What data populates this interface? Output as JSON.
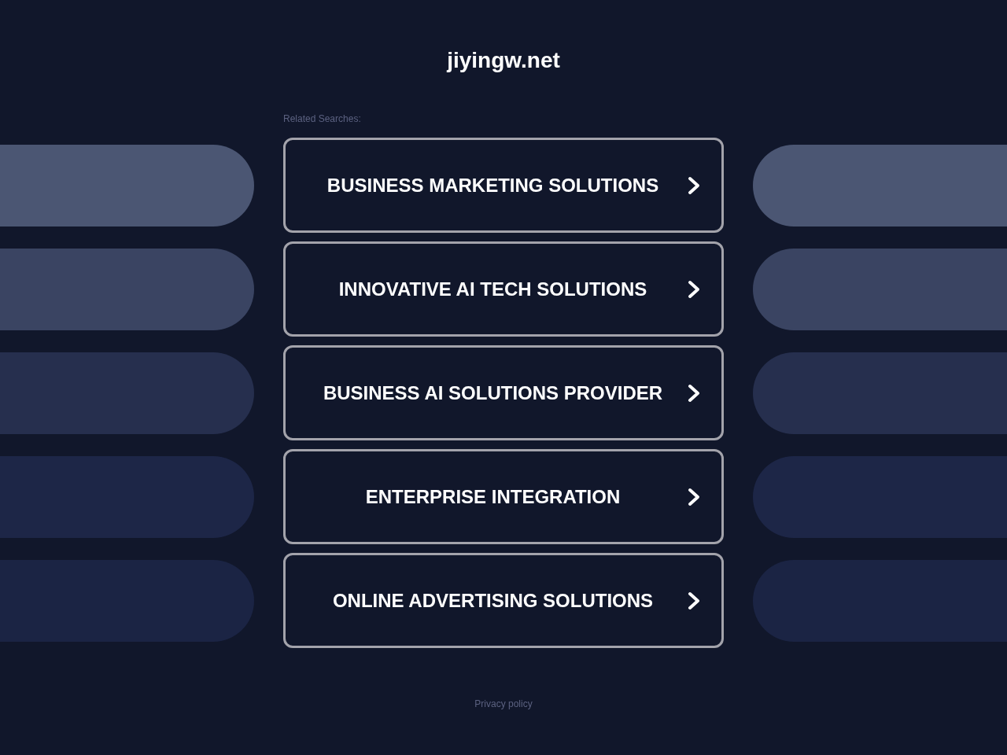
{
  "site_title": "jiyingw.net",
  "related_searches": {
    "label": "Related Searches:",
    "links": [
      {
        "label": "BUSINESS MARKETING SOLUTIONS"
      },
      {
        "label": "INNOVATIVE AI TECH SOLUTIONS"
      },
      {
        "label": "BUSINESS AI SOLUTIONS PROVIDER"
      },
      {
        "label": "ENTERPRISE INTEGRATION"
      },
      {
        "label": "ONLINE ADVERTISING SOLUTIONS"
      }
    ]
  },
  "footer": {
    "privacy_link": "Privacy policy"
  }
}
